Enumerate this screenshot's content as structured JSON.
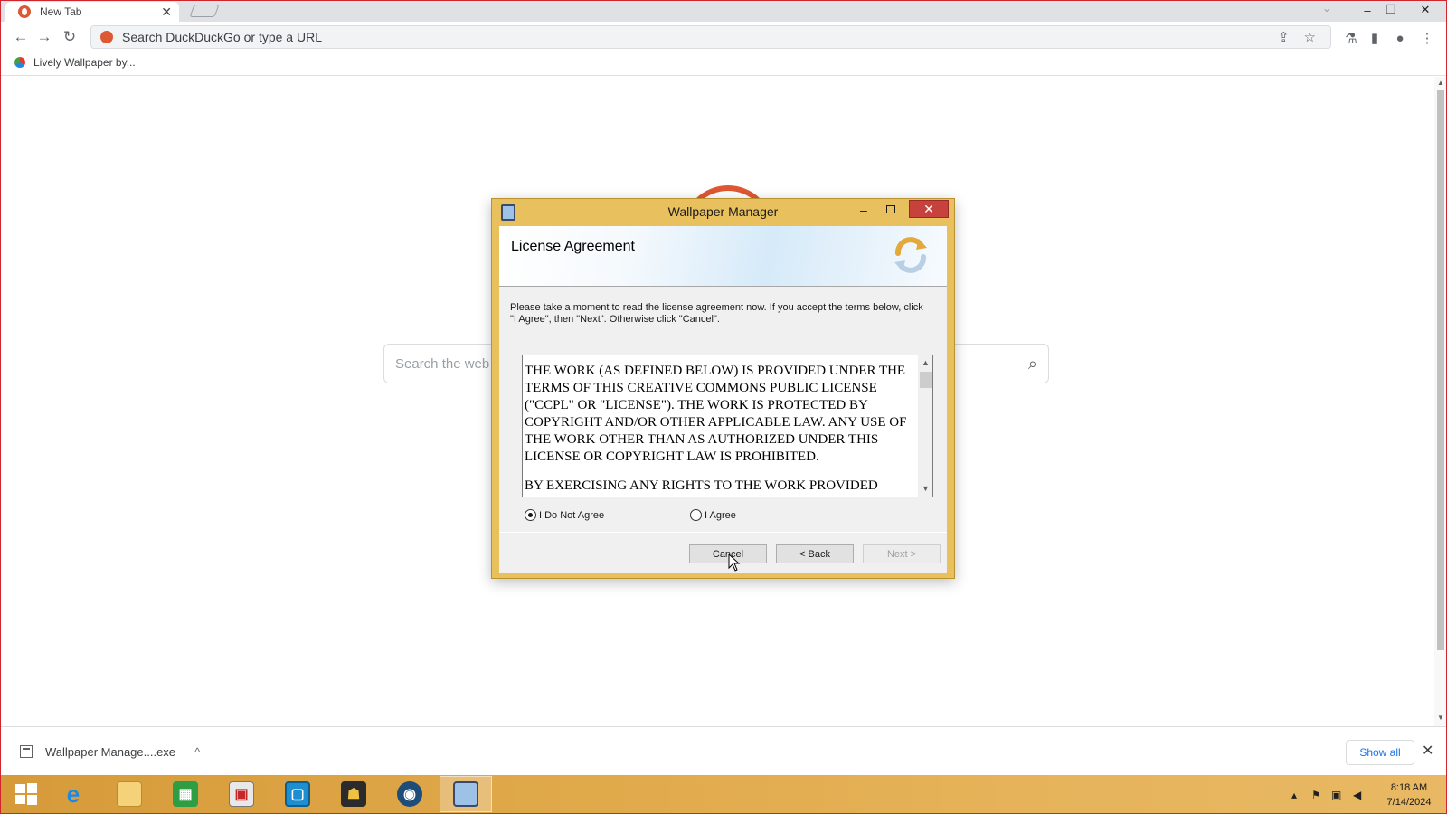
{
  "browser": {
    "tab": {
      "title": "New Tab",
      "close": "✕"
    },
    "window_controls": {
      "minimize": "–",
      "restore": "❐",
      "close": "✕"
    },
    "tab_search": "⌄",
    "toolbar": {
      "back": "←",
      "forward": "→",
      "reload": "↻",
      "omnibox_placeholder": "Search DuckDuckGo or type a URL"
    },
    "bookmarks": [
      {
        "label": "Lively Wallpaper by..."
      }
    ]
  },
  "page": {
    "search_placeholder": "Search the web without being tracked"
  },
  "dialog": {
    "title": "Wallpaper Manager",
    "title_controls": {
      "minimize": "–",
      "close": "✕"
    },
    "heading": "License Agreement",
    "instructions": "Please take a moment to read the license agreement now. If you accept the terms below, click \"I Agree\", then \"Next\". Otherwise click \"Cancel\".",
    "license_paragraphs": [
      "THE WORK (AS DEFINED BELOW) IS PROVIDED UNDER THE TERMS OF THIS CREATIVE COMMONS PUBLIC LICENSE (\"CCPL\" OR \"LICENSE\"). THE WORK IS PROTECTED BY COPYRIGHT AND/OR OTHER APPLICABLE LAW. ANY USE OF THE WORK OTHER THAN AS AUTHORIZED UNDER THIS LICENSE OR COPYRIGHT LAW IS PROHIBITED.",
      "BY EXERCISING ANY RIGHTS TO THE WORK PROVIDED"
    ],
    "radios": [
      {
        "label": "I Do Not Agree",
        "checked": true
      },
      {
        "label": "I Agree",
        "checked": false
      }
    ],
    "buttons": {
      "cancel": "Cancel",
      "back": "< Back",
      "next": "Next >"
    }
  },
  "download_shelf": {
    "file_name": "Wallpaper Manage....exe",
    "caret": "^",
    "show_all": "Show all",
    "close": "✕"
  },
  "taskbar": {
    "apps": [
      "start",
      "internet-explorer",
      "file-explorer",
      "store",
      "media-app",
      "virtualbox",
      "hacker-app",
      "steam-like-app",
      "wallpaper-installer"
    ],
    "clock_time": "8:18 AM",
    "clock_date": "7/14/2024"
  },
  "colors": {
    "accent_dialog": "#e8c05e",
    "ddg_orange": "#de5833",
    "close_red": "#c7423c",
    "link_blue": "#1a73e8"
  }
}
